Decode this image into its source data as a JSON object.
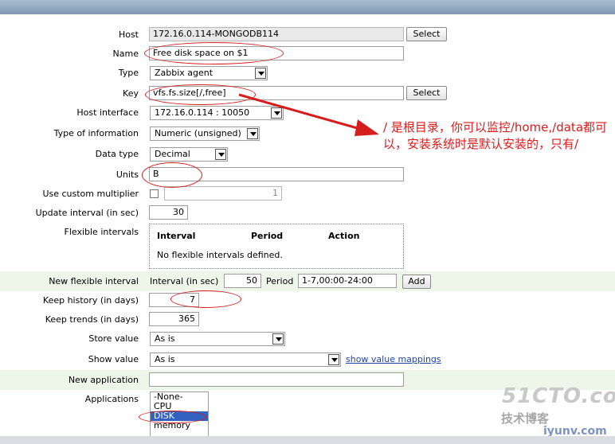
{
  "form": {
    "host": {
      "label": "Host",
      "value": "172.16.0.114-MONGODB114",
      "button": "Select"
    },
    "name": {
      "label": "Name",
      "value": "Free disk space on $1"
    },
    "type": {
      "label": "Type",
      "value": "Zabbix agent"
    },
    "key": {
      "label": "Key",
      "value": "vfs.fs.size[/,free]",
      "button": "Select"
    },
    "host_interface": {
      "label": "Host interface",
      "value": "172.16.0.114 : 10050"
    },
    "type_of_information": {
      "label": "Type of information",
      "value": "Numeric (unsigned)"
    },
    "data_type": {
      "label": "Data type",
      "value": "Decimal"
    },
    "units": {
      "label": "Units",
      "value": "B"
    },
    "custom_multiplier": {
      "label": "Use custom multiplier",
      "checked": false,
      "value": "1"
    },
    "update_interval": {
      "label": "Update interval (in sec)",
      "value": "30"
    },
    "flexible_intervals": {
      "label": "Flexible intervals",
      "columns": [
        "Interval",
        "Period",
        "Action"
      ],
      "empty_text": "No flexible intervals defined."
    },
    "new_flexible_interval": {
      "label": "New flexible interval",
      "interval_label": "Interval (in sec)",
      "interval_value": "50",
      "period_label": "Period",
      "period_value": "1-7,00:00-24:00",
      "add_button": "Add"
    },
    "keep_history": {
      "label": "Keep history (in days)",
      "value": "7"
    },
    "keep_trends": {
      "label": "Keep trends (in days)",
      "value": "365"
    },
    "store_value": {
      "label": "Store value",
      "value": "As is"
    },
    "show_value": {
      "label": "Show value",
      "value": "As is",
      "link": "show value mappings"
    },
    "new_application": {
      "label": "New application",
      "value": ""
    },
    "applications": {
      "label": "Applications",
      "options": [
        "-None-",
        "CPU",
        "DISK",
        "memory"
      ],
      "selected": "DISK"
    }
  },
  "annotation": {
    "text": "/ 是根目录，你可以监控/home,/data都可以，安装系统时是默认安装的，只有/",
    "color": "#e0191a"
  },
  "watermark": {
    "logo": "51CTO.com",
    "tagline": "技术博客",
    "site": "iyunv.com"
  },
  "colors": {
    "band": "#eef6ea",
    "highlight_ring": "#d61d1d",
    "listbox_selected": "#3161c1"
  }
}
